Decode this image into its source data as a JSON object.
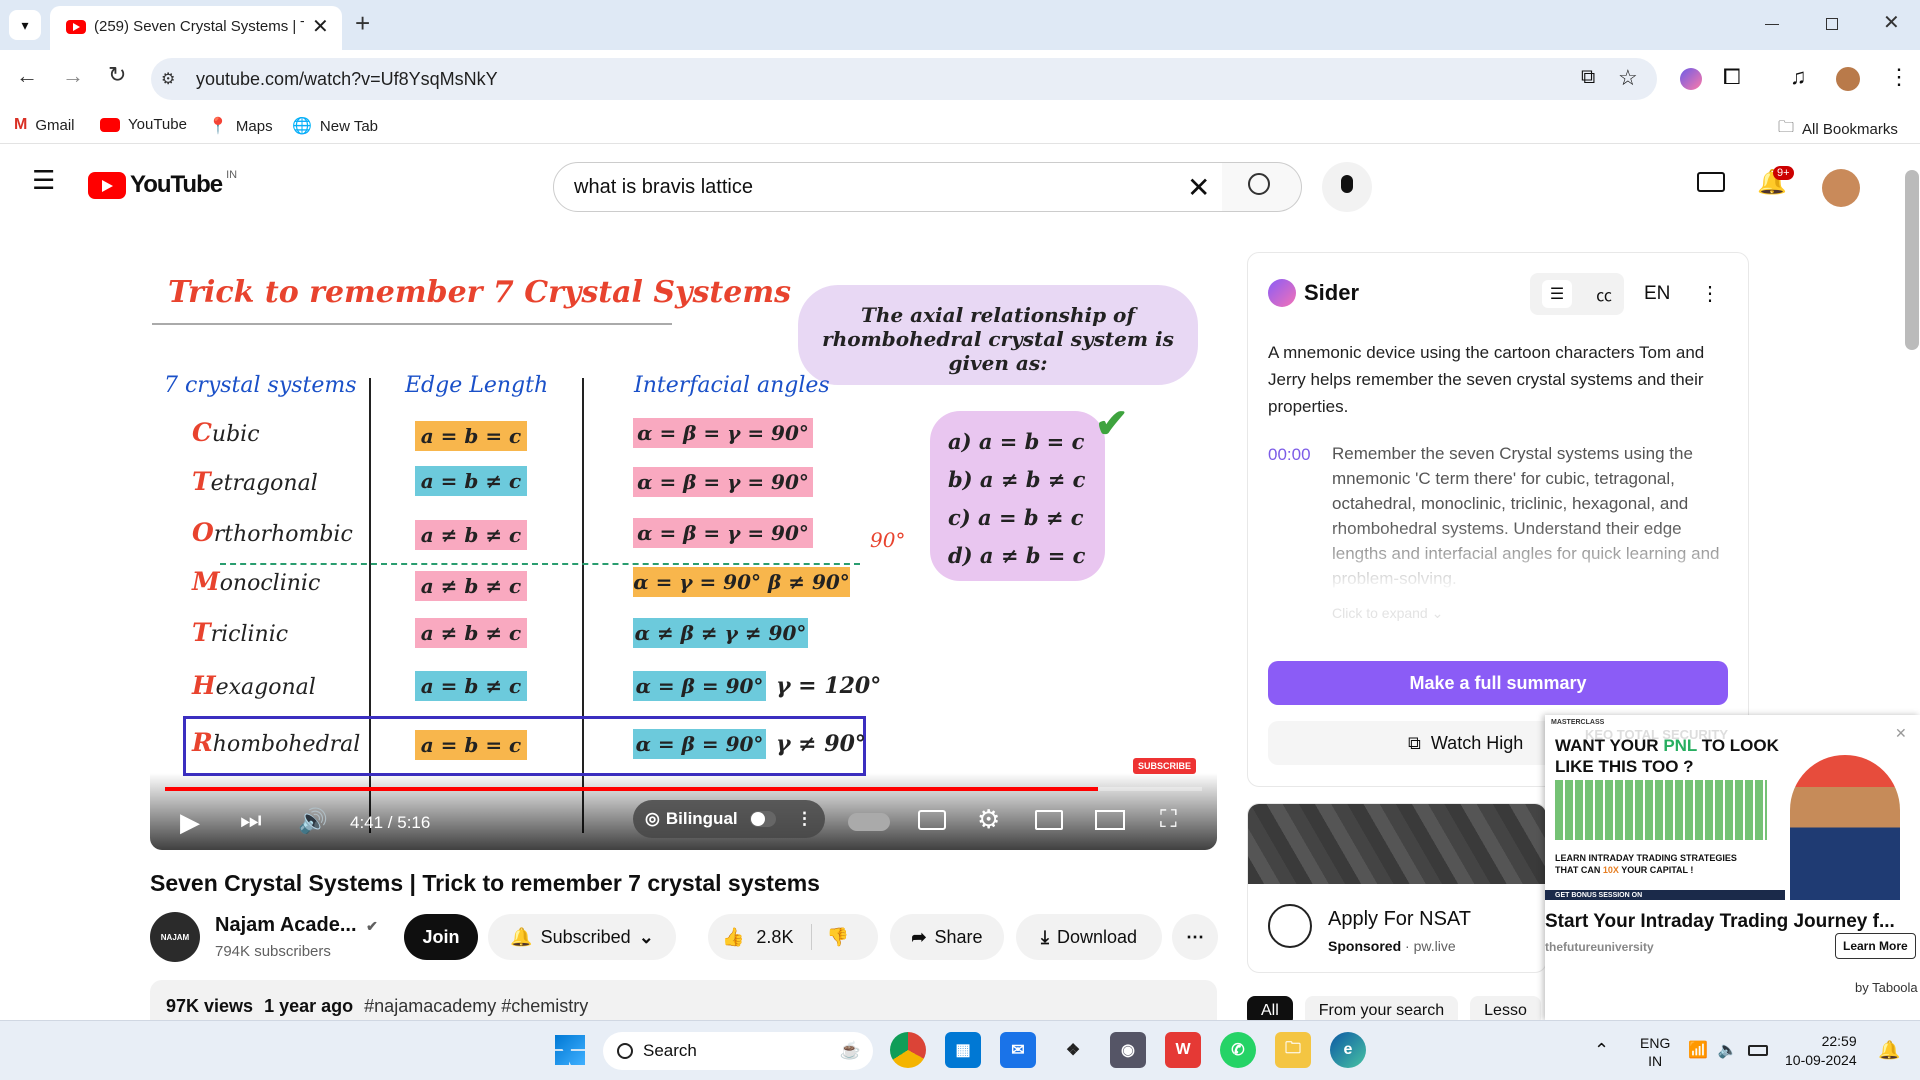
{
  "browser": {
    "tab_title": "(259) Seven Crystal Systems | Tr",
    "url": "youtube.com/watch?v=Uf8YsqMsNkY",
    "bookmarks": [
      {
        "label": "Gmail"
      },
      {
        "label": "YouTube"
      },
      {
        "label": "Maps"
      },
      {
        "label": "New Tab"
      }
    ],
    "all_bookmarks": "All Bookmarks"
  },
  "youtube": {
    "logo_text": "YouTube",
    "region": "IN",
    "search_value": "what is bravis lattice",
    "notif_count": "9+"
  },
  "video": {
    "heading": "Trick to remember 7 Crystal Systems",
    "col_systems": "7 crystal systems",
    "col_edge": "Edge Length",
    "col_angles": "Interfacial angles",
    "question": "The axial relationship of rhombohedral crystal system is given as:",
    "rows": [
      {
        "first": "C",
        "rest": "ubic",
        "edge": "a = b = c",
        "angle": "α = β = γ = 90°",
        "extra": ""
      },
      {
        "first": "T",
        "rest": "etragonal",
        "edge": "a = b ≠ c",
        "angle": "α = β = γ = 90°",
        "extra": ""
      },
      {
        "first": "O",
        "rest": "rthorhombic",
        "edge": "a ≠ b ≠ c",
        "angle": "α = β = γ = 90°",
        "extra": ""
      },
      {
        "first": "M",
        "rest": "onoclinic",
        "edge": "a ≠ b ≠ c",
        "angle": "α = γ = 90° β ≠ 90°",
        "extra": ""
      },
      {
        "first": "T",
        "rest": "riclinic",
        "edge": "a ≠ b ≠ c",
        "angle": "α ≠ β ≠ γ ≠ 90°",
        "extra": ""
      },
      {
        "first": "H",
        "rest": "exagonal",
        "edge": "a = b ≠ c",
        "angle": "α = β = 90°",
        "extra": "γ = 120°"
      },
      {
        "first": "R",
        "rest": "hombohedral",
        "edge": "a = b = c",
        "angle": "α = β = 90°",
        "extra": "γ ≠ 90°"
      }
    ],
    "options": [
      "a) a = b = c",
      "b) a ≠ b ≠ c",
      "c) a = b ≠ c",
      "d) a ≠ b = c"
    ],
    "note_90": "90°",
    "subscribe_badge": "SUBSCRIBE",
    "time": "4:41 / 5:16",
    "progress": 0.9,
    "bilingual": "Bilingual",
    "title": "Seven Crystal Systems | Trick to remember 7 crystal systems"
  },
  "channel": {
    "name": "Najam Acade...",
    "subscribers": "794K subscribers",
    "avatar_text": "NAJAM",
    "join": "Join",
    "subscribed": "Subscribed",
    "likes": "2.8K",
    "share": "Share",
    "download": "Download"
  },
  "description": {
    "views": "97K views",
    "age": "1 year ago",
    "tags": "#najamacademy #chemistry"
  },
  "sider": {
    "title": "Sider",
    "lang": "EN",
    "summary": "A mnemonic device using the cartoon characters Tom and Jerry helps remember the seven crystal systems and their properties.",
    "timestamp": "00:00",
    "detail": "Remember the seven Crystal systems using the mnemonic 'C term there' for cubic, tetragonal, octahedral, monoclinic, triclinic, hexagonal, and rhombohedral systems. Understand their edge lengths and interfacial angles for quick learning and problem-solving.",
    "expand": "Click to expand",
    "full_summary": "Make a full summary",
    "watch": "Watch High"
  },
  "ad_nsat": {
    "title": "Apply For NSAT",
    "sponsored": "Sponsored",
    "domain": "pw.live"
  },
  "chips": [
    "All",
    "From your search",
    "Lesso"
  ],
  "ad_popup": {
    "brand": "MASTERCLASS",
    "security": "KEO TOTAL SECURITY",
    "headline1": "WANT YOUR",
    "headline_pnl": "PNL",
    "headline2": "TO LOOK",
    "headline3": "LIKE THIS TOO ?",
    "learn1": "LEARN INTRADAY TRADING STRATEGIES",
    "learn2": "THAT CAN",
    "learn_hl": "10X",
    "learn3": "YOUR CAPITAL !",
    "bonus": "GET BONUS SESSION ON",
    "title": "Start Your Intraday Trading Journey f...",
    "source": "thefutureuniversity",
    "cta": "Learn More",
    "by": "by Taboola"
  },
  "taskbar": {
    "search": "Search",
    "lang1": "ENG",
    "lang2": "IN",
    "time": "22:59",
    "date": "10-09-2024"
  }
}
